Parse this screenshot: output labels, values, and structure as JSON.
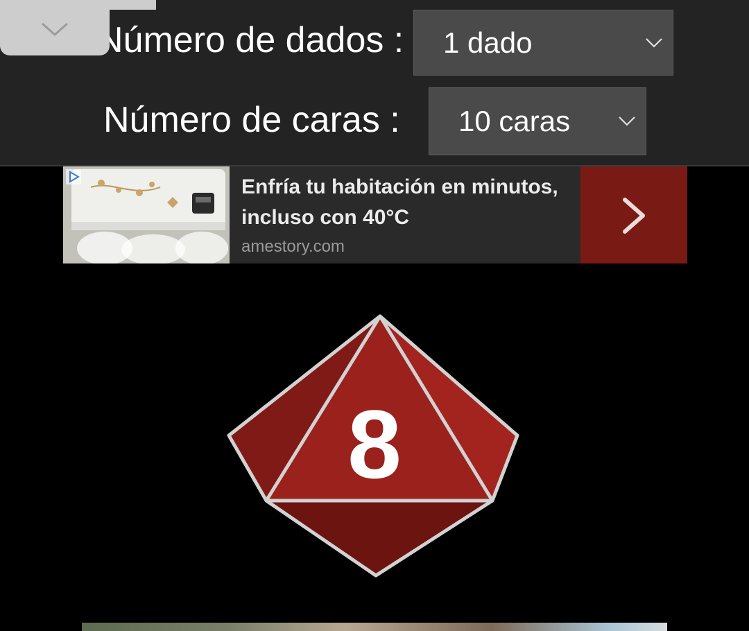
{
  "settings": {
    "dice_count": {
      "label": "Número de dados :",
      "value": "1 dado"
    },
    "face_count": {
      "label": "Número de caras :",
      "value": "10 caras"
    }
  },
  "icons": {
    "collapse": "chevron-down-icon",
    "select_arrow": "chevron-down-icon",
    "ad_cta": "chevron-right-icon",
    "ad_choices": "adchoices-icon"
  },
  "ad": {
    "headline": "Enfría tu habitación en minutos, incluso con 40°C",
    "domain": "amestory.com"
  },
  "die": {
    "result": "8",
    "color": "#a0251f"
  },
  "colors": {
    "header_bg": "#232323",
    "select_bg": "#4a4a4a",
    "ad_cta_bg": "#7a1a14",
    "page_bg": "#000000"
  }
}
